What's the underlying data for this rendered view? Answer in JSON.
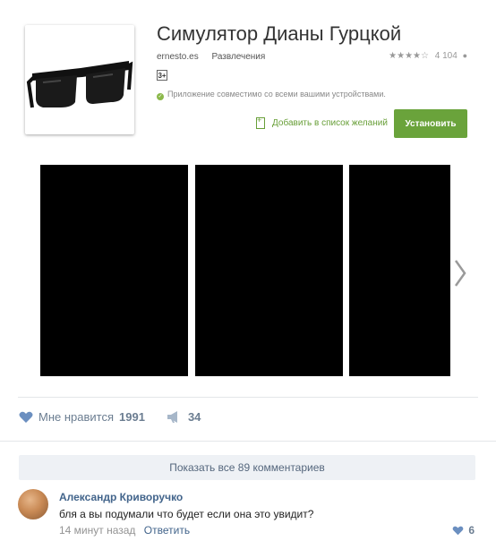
{
  "app": {
    "title": "Симулятор Дианы Гурцкой",
    "developer": "ernesto.es",
    "category": "Развлечения",
    "stars": "★★★★☆",
    "rating_count": "4 104",
    "age_rating": "3+",
    "compat_text": "Приложение совместимо со всеми вашими устройствами.",
    "wishlist_label": "Добавить в список желаний",
    "install_label": "Установить",
    "accent_color": "#6aa33b",
    "icon": "sunglasses-image"
  },
  "post": {
    "like_label": "Мне нравится",
    "like_count": "1991",
    "share_count": "34"
  },
  "comments": {
    "show_all_label": "Показать все 89 комментариев",
    "items": [
      {
        "author": "Александр Криворучко",
        "text": "бля а вы подумали что будет если она это увидит?",
        "time": "14 минут назад",
        "reply_label": "Ответить",
        "likes": "6"
      }
    ]
  }
}
